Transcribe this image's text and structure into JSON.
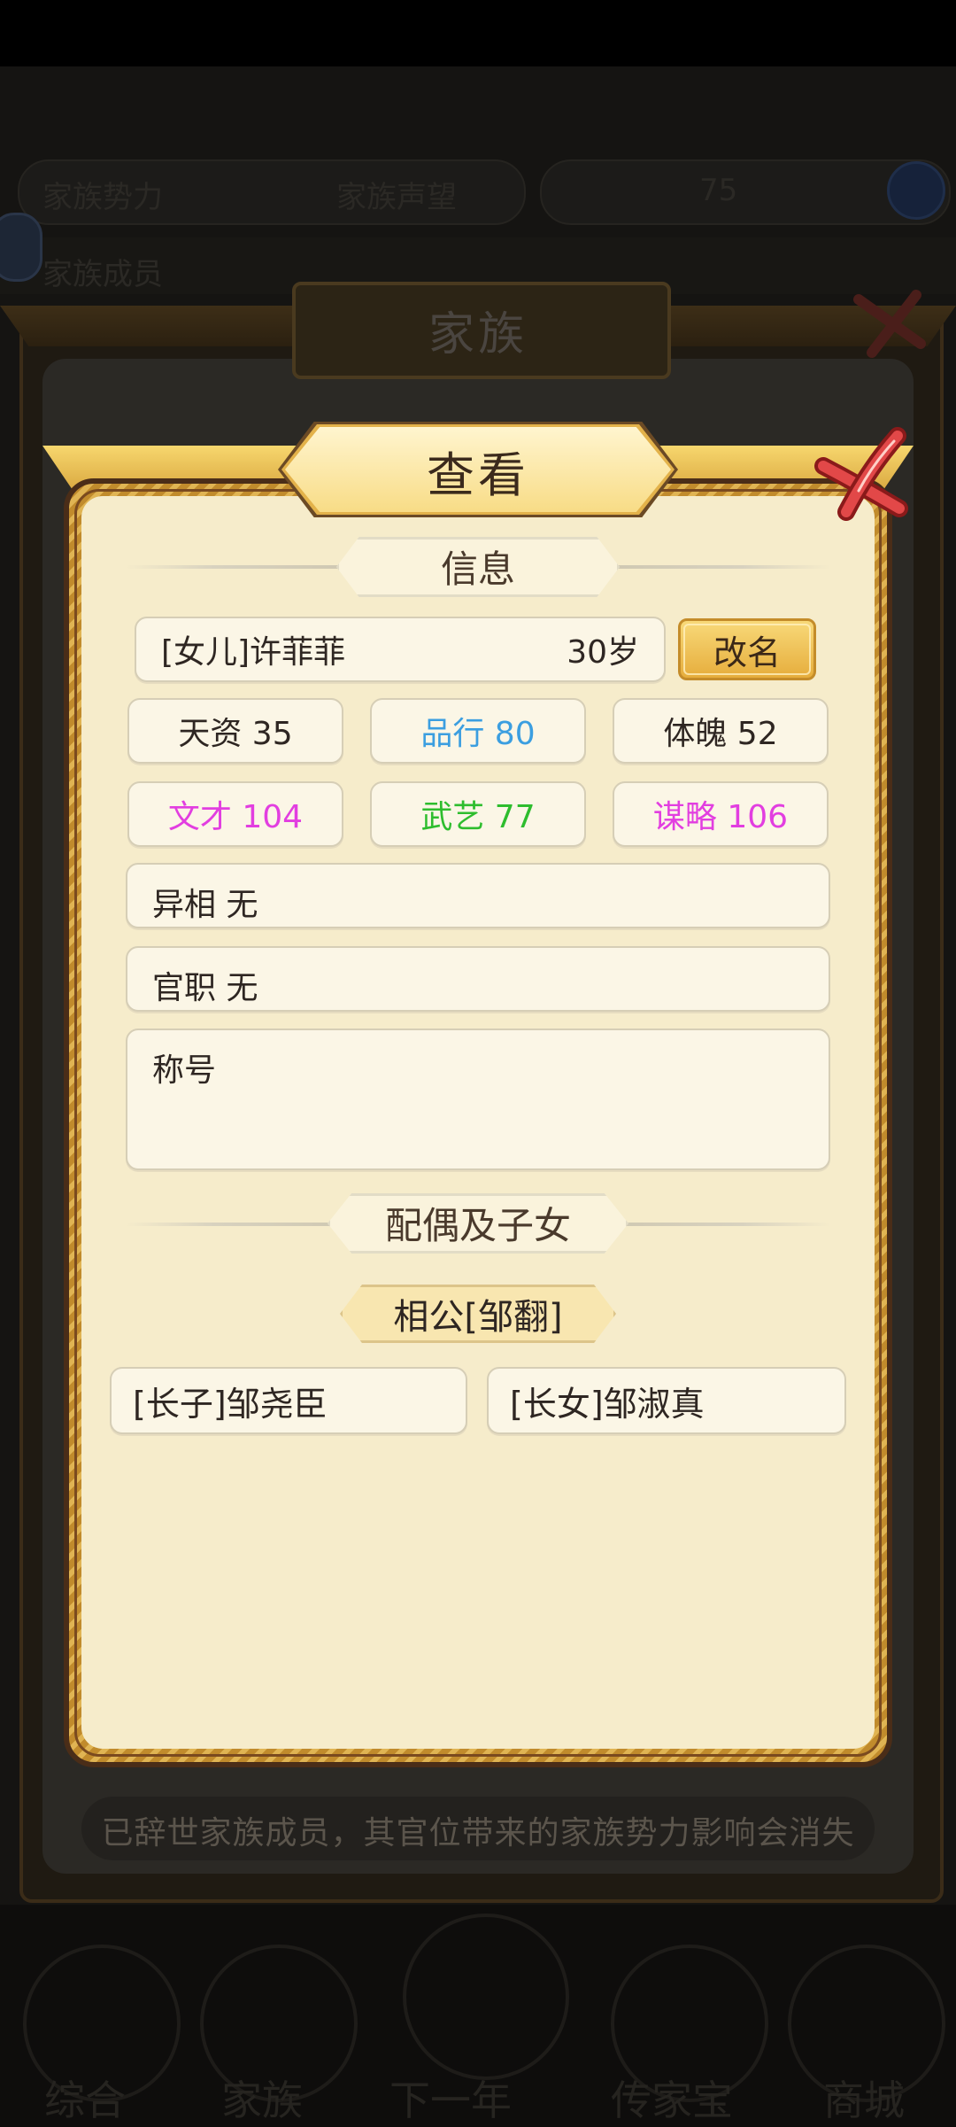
{
  "background": {
    "top_left_text": "家族势力",
    "top_mid_text": "家族声望",
    "top_right_text": "75",
    "second_row_left": "家族成员",
    "nav": [
      "综合",
      "家族",
      "下一年",
      "传家宝",
      "商城"
    ],
    "outer_dialog": {
      "title": "家族",
      "notice": "已辞世家族成员，其官位带来的家族势力影响会消失"
    }
  },
  "dialog": {
    "title": "查看",
    "info_section": "信息",
    "member_name": "[女儿]许菲菲",
    "member_age": "30岁",
    "rename_label": "改名",
    "stats": [
      {
        "label": "天资 35",
        "color": "#2e2622"
      },
      {
        "label": "品行 80",
        "color": "#3b9ee0"
      },
      {
        "label": "体魄 52",
        "color": "#2e2622"
      },
      {
        "label": "文才 104",
        "color": "#e23ee0"
      },
      {
        "label": "武艺 77",
        "color": "#2ebd2e"
      },
      {
        "label": "谋略 106",
        "color": "#e23ee0"
      }
    ],
    "appearance": "异相 无",
    "official_post": "官职 无",
    "title_label": "称号",
    "family_section": "配偶及子女",
    "spouse": "相公[邹翻]",
    "children": [
      "[长子]邹尧臣",
      "[长女]邹淑真"
    ]
  },
  "colors": {
    "dialog_bg": "#f6eccb",
    "frame_gold": "#cf9a34",
    "rename_gold": "#eec25a",
    "close_red": "#d83a3a"
  }
}
